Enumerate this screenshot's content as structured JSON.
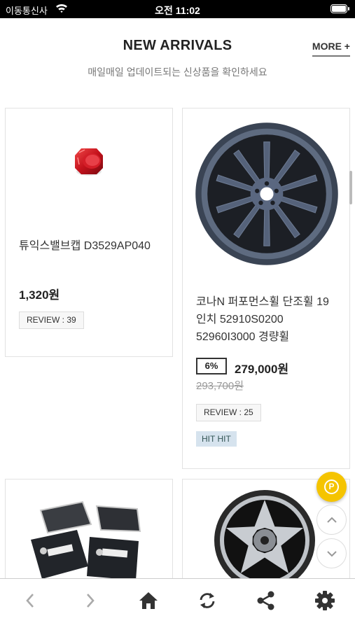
{
  "status_bar": {
    "carrier": "이동통신사",
    "time": "오전 11:02"
  },
  "section": {
    "title": "NEW ARRIVALS",
    "more_label": "MORE +",
    "subtitle": "매일매일 업데이트되는 신상품을 확인하세요"
  },
  "products": [
    {
      "name": "튜익스밸브캡 D3529AP040",
      "price": "1,320원",
      "review": "REVIEW : 39",
      "image_icon": "red-valve-cap-image"
    },
    {
      "name": "코나N 퍼포먼스휠 단조휠 19인치 52910S0200 52960I3000 경량휠",
      "discount": "6%",
      "price": "279,000원",
      "old_price": "293,700원",
      "review": "REVIEW : 25",
      "badge": "HIT HIT",
      "image_icon": "dark-alloy-wheel-image"
    },
    {
      "image_icon": "brake-pads-image"
    },
    {
      "image_icon": "silver-black-wheel-image"
    }
  ],
  "floating": {
    "point_label": "P"
  },
  "bottom_nav": [
    "back-icon",
    "forward-icon",
    "home-icon",
    "refresh-icon",
    "share-icon",
    "settings-icon"
  ],
  "colors": {
    "point_button": "#f5c400",
    "hit_badge_bg": "#d6e3ee",
    "status_bar_bg": "#000000"
  }
}
